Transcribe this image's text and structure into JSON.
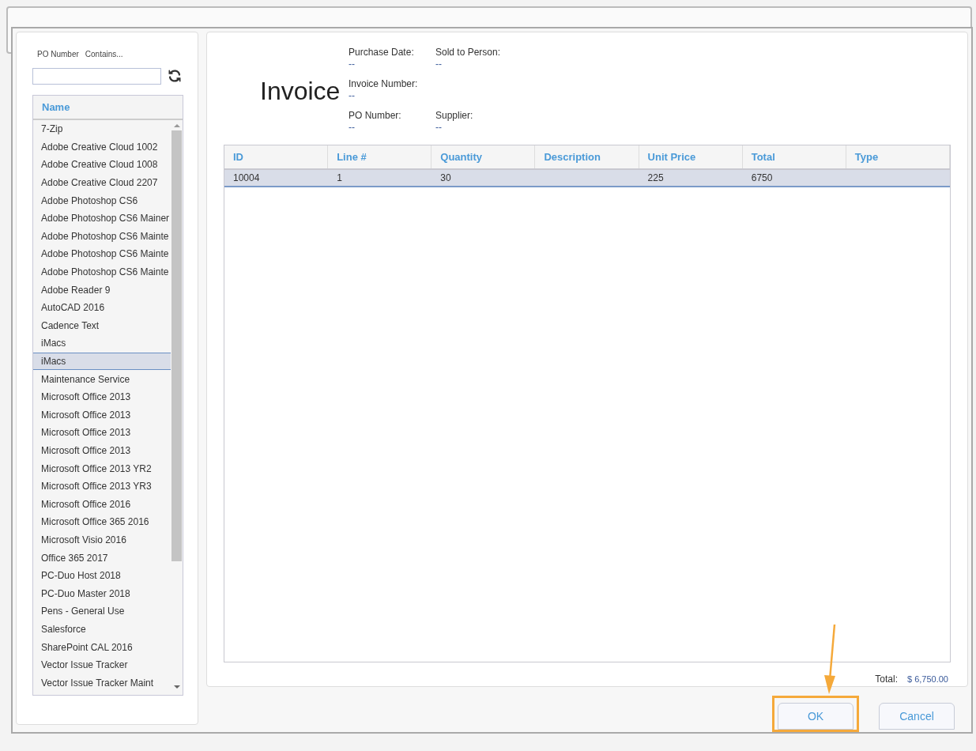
{
  "filter": {
    "field_label": "PO Number",
    "operator_label": "Contains..."
  },
  "list": {
    "column": "Name",
    "items": [
      {
        "label": "7-Zip",
        "selected": false
      },
      {
        "label": "Adobe Creative Cloud 1002",
        "selected": false
      },
      {
        "label": "Adobe Creative Cloud 1008",
        "selected": false
      },
      {
        "label": "Adobe Creative Cloud 2207",
        "selected": false
      },
      {
        "label": "Adobe Photoshop CS6",
        "selected": false
      },
      {
        "label": "Adobe Photoshop CS6 Mainer",
        "selected": false
      },
      {
        "label": "Adobe Photoshop CS6 Mainte",
        "selected": false
      },
      {
        "label": "Adobe Photoshop CS6 Mainte",
        "selected": false
      },
      {
        "label": "Adobe Photoshop CS6 Mainte",
        "selected": false
      },
      {
        "label": "Adobe Reader 9",
        "selected": false
      },
      {
        "label": "AutoCAD 2016",
        "selected": false
      },
      {
        "label": "Cadence Text",
        "selected": false
      },
      {
        "label": "iMacs",
        "selected": false
      },
      {
        "label": "iMacs",
        "selected": true
      },
      {
        "label": "Maintenance Service",
        "selected": false
      },
      {
        "label": "Microsoft Office 2013",
        "selected": false
      },
      {
        "label": "Microsoft Office 2013",
        "selected": false
      },
      {
        "label": "Microsoft Office 2013",
        "selected": false
      },
      {
        "label": "Microsoft Office 2013",
        "selected": false
      },
      {
        "label": "Microsoft Office 2013 YR2",
        "selected": false
      },
      {
        "label": "Microsoft Office 2013 YR3",
        "selected": false
      },
      {
        "label": "Microsoft Office 2016",
        "selected": false
      },
      {
        "label": "Microsoft Office 365 2016",
        "selected": false
      },
      {
        "label": "Microsoft Visio 2016",
        "selected": false
      },
      {
        "label": "Office 365 2017",
        "selected": false
      },
      {
        "label": "PC-Duo Host 2018",
        "selected": false
      },
      {
        "label": "PC-Duo Master 2018",
        "selected": false
      },
      {
        "label": "Pens - General Use",
        "selected": false
      },
      {
        "label": "Salesforce",
        "selected": false
      },
      {
        "label": "SharePoint CAL 2016",
        "selected": false
      },
      {
        "label": "Vector Issue Tracker",
        "selected": false
      },
      {
        "label": "Vector Issue Tracker Maint",
        "selected": false
      }
    ]
  },
  "invoice": {
    "title": "Invoice",
    "fields": [
      {
        "label": "Purchase Date:",
        "value": "--"
      },
      {
        "label": "Sold to Person:",
        "value": "--"
      },
      {
        "label": "Invoice Number:",
        "value": "--"
      },
      {
        "label": "PO Number:",
        "value": "--"
      },
      {
        "label": "Supplier:",
        "value": "--"
      }
    ]
  },
  "table": {
    "columns": [
      "ID",
      "Line #",
      "Quantity",
      "Description",
      "Unit Price",
      "Total",
      "Type"
    ],
    "rows": [
      {
        "selected": true,
        "cells": [
          "10004",
          "1",
          "30",
          "",
          "225",
          "6750",
          ""
        ]
      }
    ]
  },
  "total": {
    "label": "Total:",
    "value": "$ 6,750.00"
  },
  "buttons": [
    {
      "label": "OK",
      "highlighted": true
    },
    {
      "label": "Cancel",
      "highlighted": false
    }
  ]
}
